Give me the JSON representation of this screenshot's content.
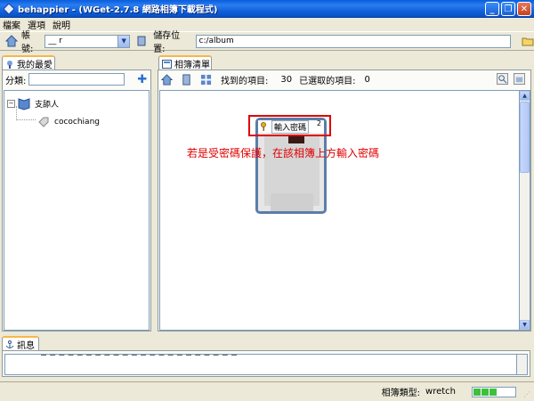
{
  "window": {
    "title": "behappier - (WGet-2.7.8 網路相簿下載程式)"
  },
  "menu": {
    "items": [
      "檔案",
      "選項",
      "說明"
    ]
  },
  "toolbar": {
    "account_label": "帳號:",
    "account_value": "__ r",
    "save_location_label": "儲存位置:",
    "save_location_value": "c:/album"
  },
  "left_panel": {
    "tab_label": "我的最愛",
    "category_label": "分類:",
    "tree": {
      "group": "支舔人",
      "user": "cocochiang"
    }
  },
  "right_panel": {
    "tab_label": "相簿清單",
    "found_label": "找到的項目:",
    "found_count": "30",
    "selected_label": "已選取的項目:",
    "selected_count": "0",
    "album": {
      "password_label": "輸入密碼",
      "count": "2"
    },
    "annotation": "若是受密碼保護，在該相簿上方輸入密碼"
  },
  "messages": {
    "tab_label": "訊息"
  },
  "status": {
    "label": "相簿類型:",
    "value": "wretch",
    "signal_level": 0.6
  },
  "colors": {
    "annotation": "#e00000",
    "titlebar": "#0a5ddc",
    "tab_accent": "#f7b64b",
    "signal": "#3ec03e"
  }
}
